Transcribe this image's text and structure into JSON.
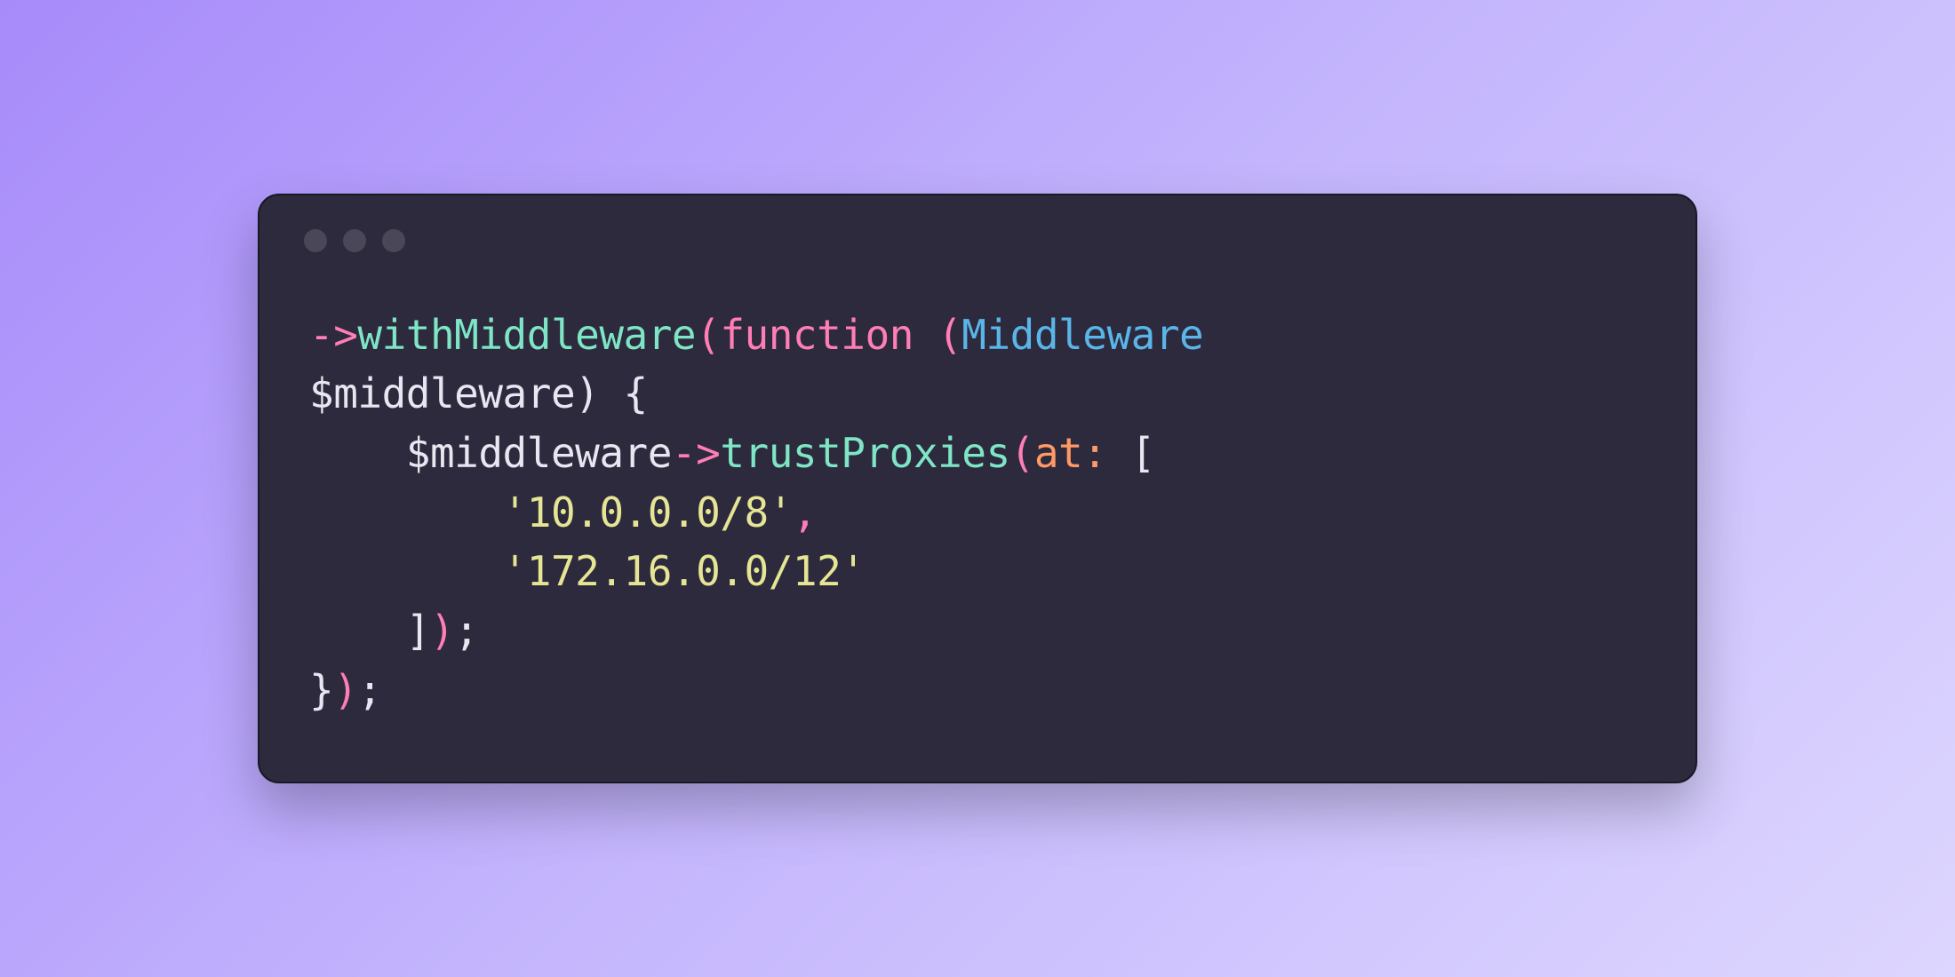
{
  "code": {
    "line1": {
      "arrow": "->",
      "method": "withMiddleware",
      "paren_open": "(",
      "keyword": "function",
      "space_paren": " (",
      "type": "Middleware"
    },
    "line2": {
      "variable": "$middleware",
      "paren_close_brace": ") {"
    },
    "line3": {
      "indent": "    ",
      "variable": "$middleware",
      "arrow": "->",
      "method": "trustProxies",
      "paren_open": "(",
      "named_arg": "at:",
      "bracket": " ["
    },
    "line4": {
      "indent": "        ",
      "string": "'10.0.0.0/8'",
      "comma": ","
    },
    "line5": {
      "indent": "        ",
      "string": "'172.16.0.0/12'"
    },
    "line6": {
      "indent": "    ",
      "bracket_close": "]",
      "paren_close": ")",
      "semicolon": ";"
    },
    "line7": {
      "brace_close": "}",
      "paren_close": ")",
      "semicolon": ";"
    }
  }
}
